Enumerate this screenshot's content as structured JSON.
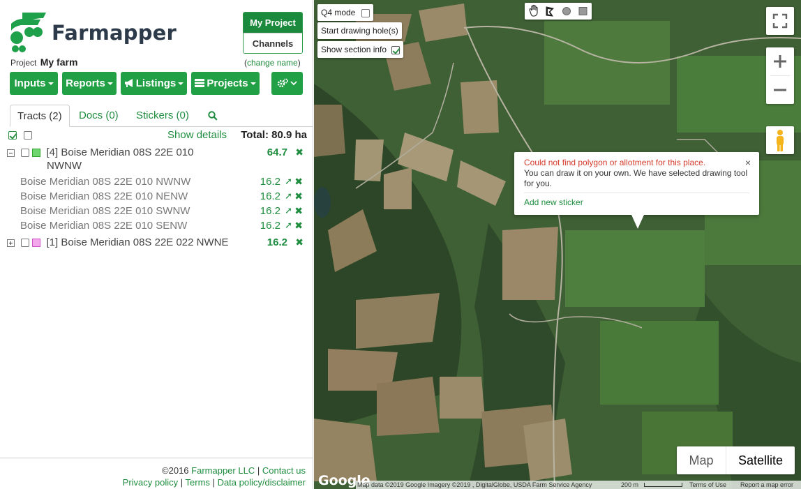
{
  "brand": {
    "name": "Farmapper"
  },
  "project_switch": {
    "active": "My Project",
    "inactive": "Channels"
  },
  "project": {
    "label": "Project",
    "name": "My farm",
    "change_label": "change name",
    "paren_open": "(",
    "paren_close": ")"
  },
  "toolbar": {
    "inputs": "Inputs",
    "reports": "Reports",
    "listings": "Listings",
    "projects": "Projects"
  },
  "tabs": [
    {
      "label": "Tracts (2)"
    },
    {
      "label": "Docs  (0)"
    },
    {
      "label": "Stickers  (0)"
    }
  ],
  "summary": {
    "show_details": "Show details",
    "total": "Total: 80.9 ha"
  },
  "tracts": [
    {
      "name_line1": "[4] Boise Meridian 08S 22E 010",
      "name_line2": "NWNW",
      "area": "64.7",
      "color": "#3fbf3f",
      "children": [
        {
          "name": "Boise Meridian 08S 22E 010 NWNW",
          "area": "16.2"
        },
        {
          "name": "Boise Meridian 08S 22E 010 NENW",
          "area": "16.2"
        },
        {
          "name": "Boise Meridian 08S 22E 010 SWNW",
          "area": "16.2"
        },
        {
          "name": "Boise Meridian 08S 22E 010 SENW",
          "area": "16.2"
        }
      ]
    },
    {
      "name_line1": "[1] Boise Meridian 08S 22E 022 NWNE",
      "area": "16.2",
      "color": "#e36ad6"
    }
  ],
  "footer": {
    "copyright": "©2016",
    "company": "Farmapper LLC",
    "sep": "|",
    "contact": "Contact us",
    "privacy": "Privacy policy",
    "terms": "Terms",
    "data_policy": "Data policy/disclaimer"
  },
  "map_controls": {
    "q4_mode": "Q4 mode",
    "start_drawing_hole": "Start drawing hole(s)",
    "show_section_info": "Show section info"
  },
  "popup": {
    "error": "Could not find polygon or allotment for this place.",
    "info": "You can draw it on your own. We have selected drawing tool for you.",
    "add_sticker": "Add new sticker",
    "close": "×"
  },
  "map_type": {
    "map": "Map",
    "satellite": "Satellite"
  },
  "attribution": {
    "google": "Google",
    "map_data": "Map data ©2019 Google Imagery ©2019 , DigitalGlobe, USDA Farm Service Agency",
    "scale": "200 m",
    "terms": "Terms of Use",
    "report": "Report a map error"
  },
  "colors": {
    "brand_green": "#22a046",
    "dark_green": "#1c8a3c",
    "error_red": "#d53a2a"
  }
}
